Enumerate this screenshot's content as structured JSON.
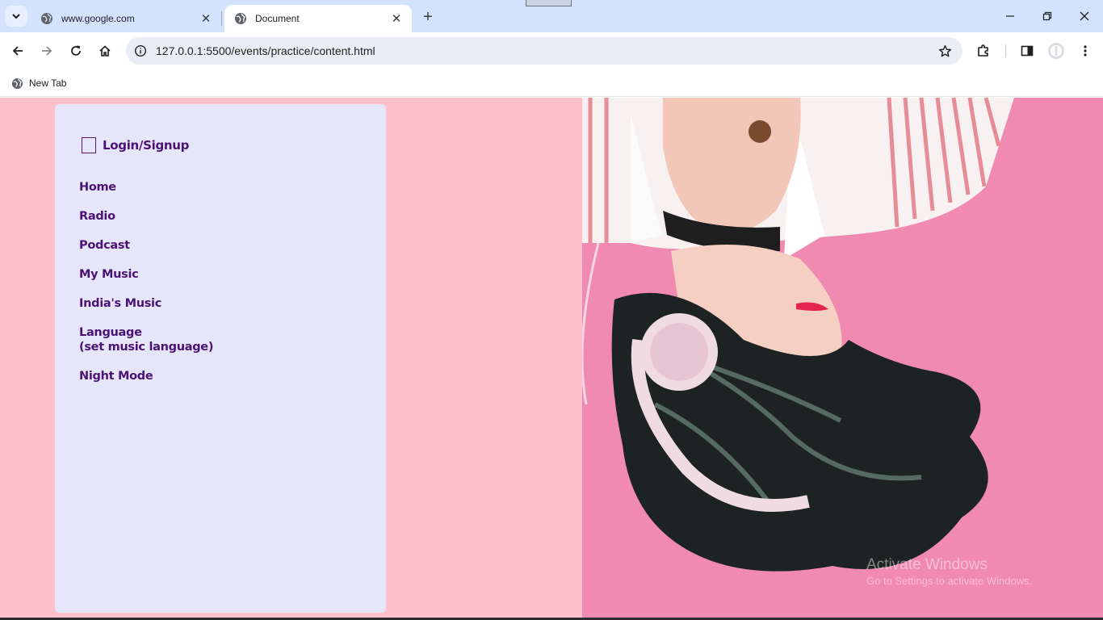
{
  "browser": {
    "tabs": [
      {
        "title": "www.google.com",
        "active": false
      },
      {
        "title": "Document",
        "active": true
      }
    ],
    "address": "127.0.0.1:5500/events/practice/content.html",
    "bookmarks": [
      {
        "label": "New Tab"
      }
    ]
  },
  "sidebar": {
    "login_label": "Login/Signup",
    "nav": [
      {
        "label": "Home"
      },
      {
        "label": "Radio"
      },
      {
        "label": "Podcast"
      },
      {
        "label": "My Music"
      },
      {
        "label": "India's Music"
      },
      {
        "label": "Language",
        "sub": "(set music language)"
      },
      {
        "label": "Night Mode"
      }
    ]
  },
  "watermark": {
    "line1": "Activate Windows",
    "line2": "Go to Settings to activate Windows."
  },
  "colors": {
    "page_bg": "#ffc0cb",
    "sidebar_bg": "#e6e6fa",
    "nav_text": "#4b1375",
    "hero_bg": "#f08ab0"
  }
}
